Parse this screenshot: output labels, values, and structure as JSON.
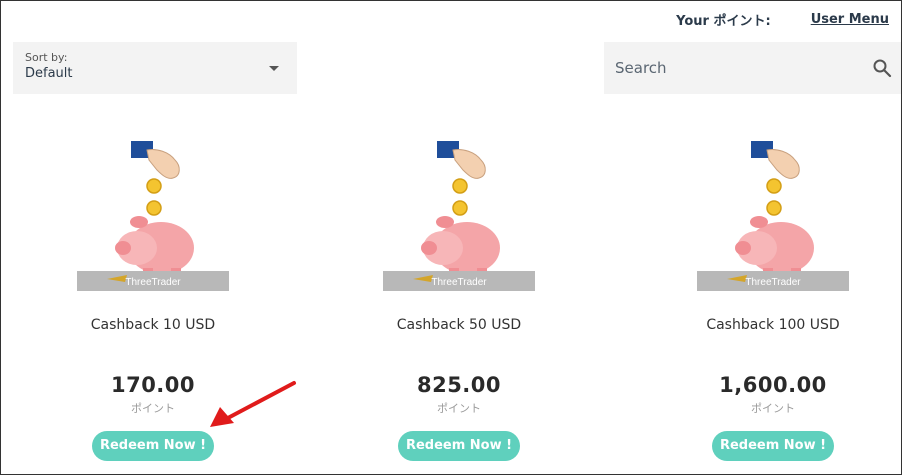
{
  "header": {
    "points_label": "Your ポイント:",
    "points_value": "",
    "user_menu": "User Menu"
  },
  "sort": {
    "label": "Sort by:",
    "value": "Default"
  },
  "search": {
    "placeholder": "Search"
  },
  "products": [
    {
      "title": "Cashback 10 USD",
      "price": "170.00",
      "unit": "ポイント",
      "button": "Redeem Now !",
      "brand": "ThreeTrader"
    },
    {
      "title": "Cashback 50 USD",
      "price": "825.00",
      "unit": "ポイント",
      "button": "Redeem Now !",
      "brand": "ThreeTrader"
    },
    {
      "title": "Cashback 100 USD",
      "price": "1,600.00",
      "unit": "ポイント",
      "button": "Redeem Now !",
      "brand": "ThreeTrader"
    }
  ],
  "colors": {
    "accent": "#5fd0bd",
    "annotation_arrow": "#e01b1b",
    "panel_bg": "#f3f3f3"
  },
  "icons": {
    "search": "search-icon",
    "dropdown": "chevron-down-icon",
    "product_image": "piggy-bank-icon"
  }
}
